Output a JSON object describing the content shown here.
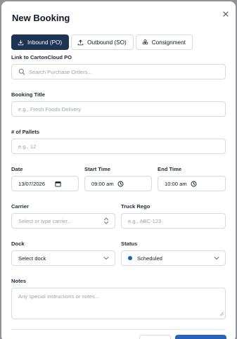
{
  "modal": {
    "title": "New Booking"
  },
  "tabs": [
    {
      "label": "Inbound (PO)",
      "icon": "download-icon",
      "active": true
    },
    {
      "label": "Outbound (SO)",
      "icon": "upload-icon",
      "active": false
    },
    {
      "label": "Consignment",
      "icon": "boxes-icon",
      "active": false
    }
  ],
  "link_po": {
    "label": "Link to CartonCloud PO",
    "placeholder": "Search Purchase Orders..."
  },
  "booking_title": {
    "label": "Booking Title",
    "placeholder": "e.g., Fresh Foods Delivery"
  },
  "pallets": {
    "label": "# of Pallets",
    "placeholder": "e.g., 12"
  },
  "date": {
    "label": "Date",
    "value": "13/07/2026"
  },
  "start_time": {
    "label": "Start Time",
    "value": "09:00 am"
  },
  "end_time": {
    "label": "End Time",
    "value": "10:00 am"
  },
  "carrier": {
    "label": "Carrier",
    "placeholder": "Select or type carrier..."
  },
  "truck_rego": {
    "label": "Truck Rego",
    "placeholder": "e.g., ABC-123"
  },
  "dock": {
    "label": "Dock",
    "value": "Select dock"
  },
  "status": {
    "label": "Status",
    "value": "Scheduled",
    "dot_color": "#1d5fb5"
  },
  "notes": {
    "label": "Notes",
    "placeholder": "Any special instructions or notes..."
  },
  "colors": {
    "active_tab": "#1d3454",
    "primary_button": "#2b63b8"
  }
}
